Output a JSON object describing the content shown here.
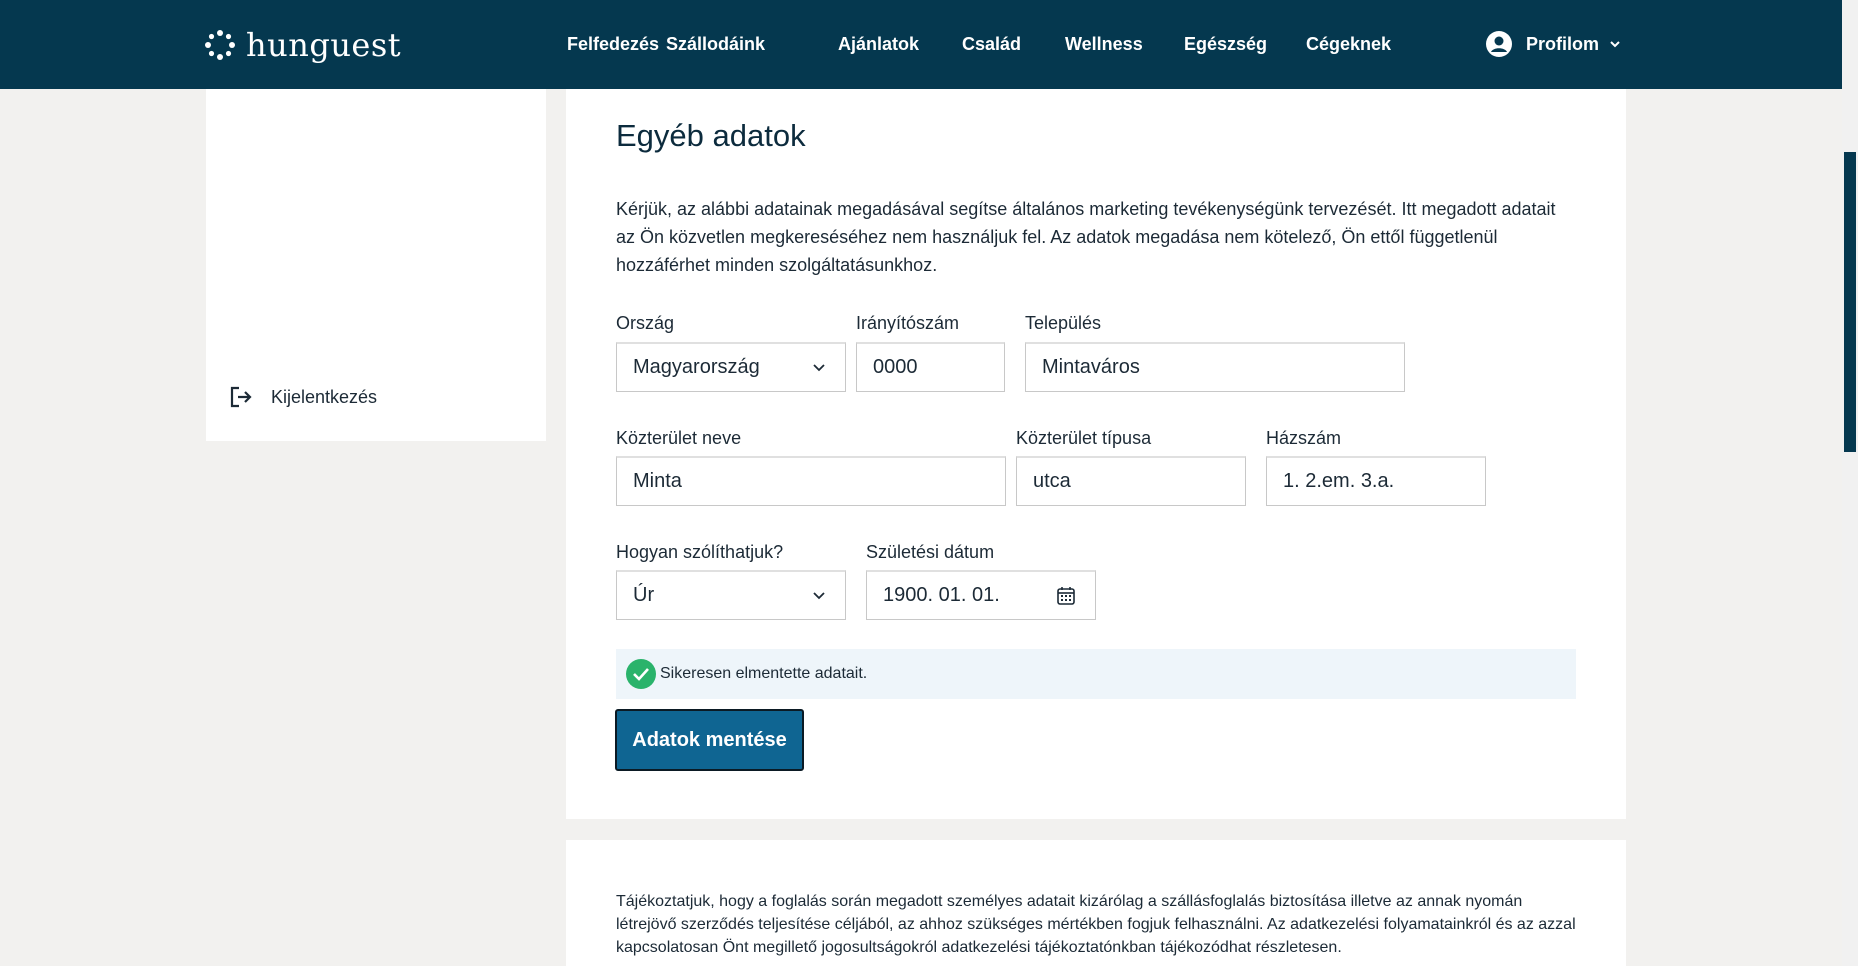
{
  "header": {
    "brand": "hunguest",
    "nav": [
      "Felfedezés",
      "Szállodáink",
      "Ajánlatok",
      "Család",
      "Wellness",
      "Egészség",
      "Cégeknek"
    ],
    "profile_label": "Profilom",
    "bg_color": "#05384f"
  },
  "sidebar": {
    "logout_label": "Kijelentkezés"
  },
  "form": {
    "title": "Egyéb adatok",
    "intro": "Kérjük, az alábbi adatainak megadásával segítse általános marketing tevékenységünk tervezését. Itt megadott adatait az Ön közvetlen megkereséséhez nem használjuk fel. Az adatok megadása nem kötelező, Ön ettől függetlenül hozzáférhet minden szolgáltatásunkhoz.",
    "country": {
      "label": "Ország",
      "value": "Magyarország"
    },
    "zip": {
      "label": "Irányítószám",
      "value": "0000"
    },
    "city": {
      "label": "Település",
      "value": "Mintaváros"
    },
    "street_name": {
      "label": "Közterület neve",
      "value": "Minta"
    },
    "street_type": {
      "label": "Közterület típusa",
      "value": "utca"
    },
    "house_number": {
      "label": "Házszám",
      "value": "1. 2.em. 3.a."
    },
    "salutation": {
      "label": "Hogyan szólíthatjuk?",
      "value": "Úr"
    },
    "birth_date": {
      "label": "Születési dátum",
      "value": "1900. 01. 01."
    },
    "success_message": "Sikeresen elmentette adatait.",
    "save_button": "Adatok mentése"
  },
  "notice": "Tájékoztatjuk, hogy a foglalás során megadott személyes adatait kizárólag a szállásfoglalás biztosítása illetve az annak nyomán létrejövő szerződés teljesítése céljából, az ahhoz szükséges mértékben fogjuk felhasználni. Az adatkezelési folyamatainkról és az azzal kapcsolatosan Önt megillető jogosultságokról adatkezelési tájékoztatónkban tájékozódhat részletesen.",
  "colors": {
    "accent": "#0f6592",
    "success": "#2ab36b",
    "success_bg": "#eef5fa"
  }
}
